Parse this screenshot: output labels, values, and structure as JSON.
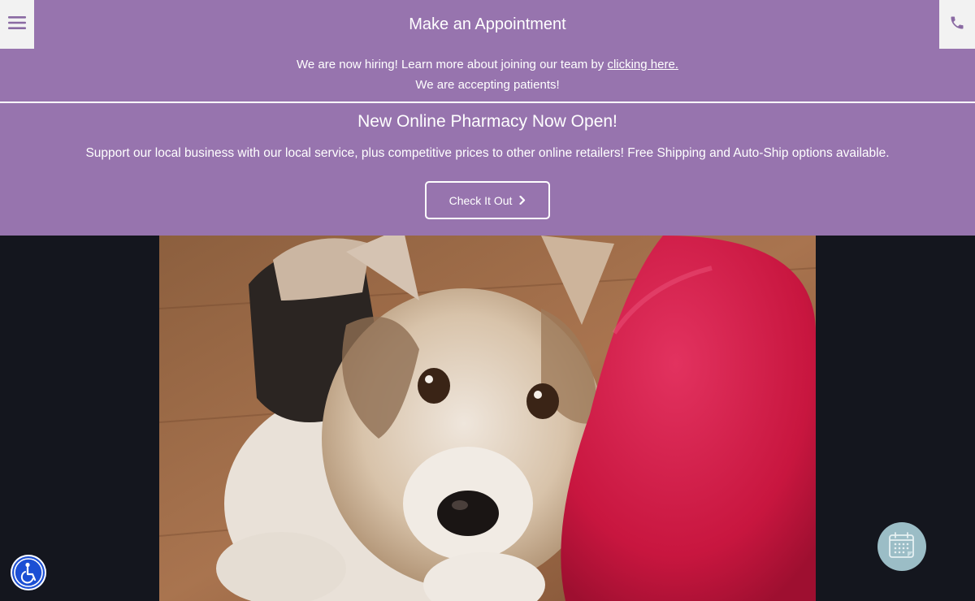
{
  "header": {
    "title": "Make an Appointment",
    "menu_icon": "hamburger-menu-icon",
    "phone_icon": "phone-icon"
  },
  "notice": {
    "hiring_text": "We are now hiring! Learn more about joining our team by ",
    "hiring_link": "clicking here.",
    "accepting_text": "We are accepting patients!"
  },
  "promo": {
    "headline": "New Online Pharmacy Now Open!",
    "description": "Support our local business with our local service, plus competitive prices to other online retailers! Free Shipping and Auto-Ship options available.",
    "cta_label": "Check It Out",
    "cta_icon": "chevron-right-icon"
  },
  "hero": {
    "subject": "corgi-dog-photo"
  },
  "floating": {
    "accessibility_icon": "accessibility-icon",
    "calendar_icon": "calendar-icon"
  },
  "colors": {
    "brand_purple": "#9774ae",
    "page_dark": "#14161e",
    "accessibility_blue": "#1c4fd4",
    "calendar_teal": "#9bbdc6"
  }
}
